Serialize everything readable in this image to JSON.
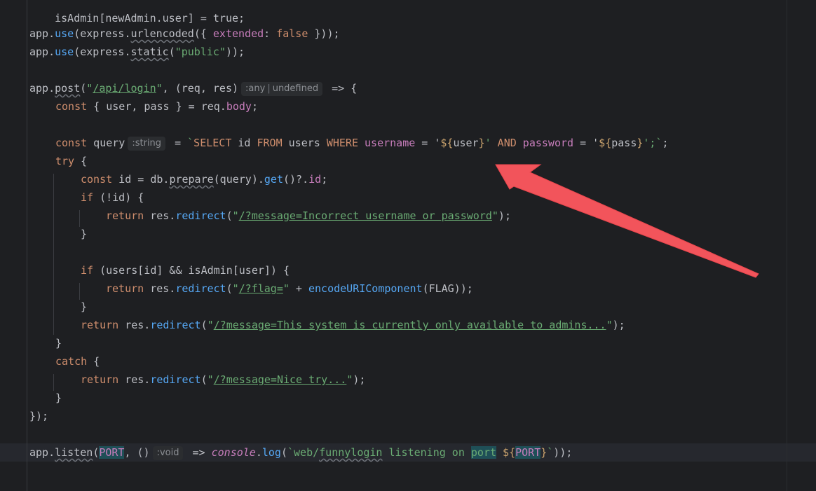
{
  "code": {
    "line_top": "isAdmin[newAdmin.user] = true;",
    "line_use_urlencoded": {
      "obj": "app",
      "dot": ".",
      "fn": "use",
      "p1": "(",
      "obj2": "express",
      "dot2": ".",
      "fn2": "urlencoded",
      "p2": "({ ",
      "prop": "extended",
      "colon": ": ",
      "kw": "false",
      "end": " }));"
    },
    "line_use_static": {
      "obj": "app",
      "dot": ".",
      "fn": "use",
      "p1": "(",
      "obj2": "express",
      "dot2": ".",
      "fn2": "static",
      "p2": "(",
      "str": "\"public\"",
      "end": "));"
    },
    "line_post": {
      "obj": "app",
      "dot": ".",
      "fn": "post",
      "p1": "(",
      "q1": "\"",
      "path": "/api/login",
      "q2": "\"",
      "mid": ", (req, res)",
      "hint_a": ":any",
      "hint_b": "undefined",
      "end": " => {"
    },
    "line_const_body": {
      "kw": "const",
      "mid": " { user, pass } = req.",
      "prop": "body",
      "end": ";"
    },
    "line_query": {
      "kw": "const",
      "name": " query",
      "hint": ":string",
      "eq": " = ",
      "bt": "`",
      "s1": "SELECT",
      "s2": " id ",
      "s3": "FROM",
      "s4": " users ",
      "s5": "WHERE",
      "s6": " username",
      "s7": " = '",
      "t1": "${",
      "v1": "user",
      "t2": "}",
      "s8": "' ",
      "s9": "AND",
      "s10": " password",
      "s11": " = '",
      "t3": "${",
      "v2": "pass",
      "t4": "}",
      "s12": "';",
      "bt2": "`",
      "end": ";"
    },
    "line_try": {
      "kw": "try",
      "end": " {"
    },
    "line_const_id": {
      "kw": "const",
      "mid": " id = db.",
      "fn": "prepare",
      "mid2": "(query).",
      "fn2": "get",
      "mid3": "()?.",
      "prop": "id",
      "end": ";"
    },
    "line_if_id": {
      "kw": "if",
      "end": " (!id) {"
    },
    "line_ret1": {
      "kw": "return",
      "mid": " res.",
      "fn": "redirect",
      "p": "(",
      "q1": "\"",
      "url": "/?message=Incorrect username or password",
      "q2": "\"",
      "end": ");"
    },
    "line_close1": "}",
    "line_if_admin": {
      "kw": "if",
      "end": " (users[id] && isAdmin[user]) {"
    },
    "line_ret2": {
      "kw": "return",
      "mid": " res.",
      "fn": "redirect",
      "p": "(",
      "q1": "\"",
      "url": "/?flag=",
      "q2": "\"",
      "plus": " + ",
      "fn2": "encodeURIComponent",
      "end": "(FLAG));"
    },
    "line_close2": "}",
    "line_ret3": {
      "kw": "return",
      "mid": " res.",
      "fn": "redirect",
      "p": "(",
      "q1": "\"",
      "url": "/?message=This system is currently only available to admins...",
      "q2": "\"",
      "end": ");"
    },
    "line_close3": "}",
    "line_catch": {
      "kw": "catch",
      "end": " {"
    },
    "line_ret4": {
      "kw": "return",
      "mid": " res.",
      "fn": "redirect",
      "p": "(",
      "q1": "\"",
      "url": "/?message=Nice try...",
      "q2": "\"",
      "end": ");"
    },
    "line_close4": "}",
    "line_close5": "});",
    "line_listen": {
      "obj": "app",
      "dot": ".",
      "fn": "listen",
      "p": "(",
      "port": "PORT",
      "mid": ", ()",
      "hint": ":void",
      "arrow": " => ",
      "console": "console",
      "dot2": ".",
      "fn2": "log",
      "p2": "(",
      "bt": "`",
      "txt1": "web/",
      "txt2": "funnylogin",
      "txt3": " listening on ",
      "txt4": "port",
      "txt5": " ",
      "t1": "${",
      "port2": "PORT",
      "t2": "}",
      "bt2": "`",
      "end": "));"
    }
  },
  "annotation": {
    "arrow_color": "#f2545b"
  }
}
